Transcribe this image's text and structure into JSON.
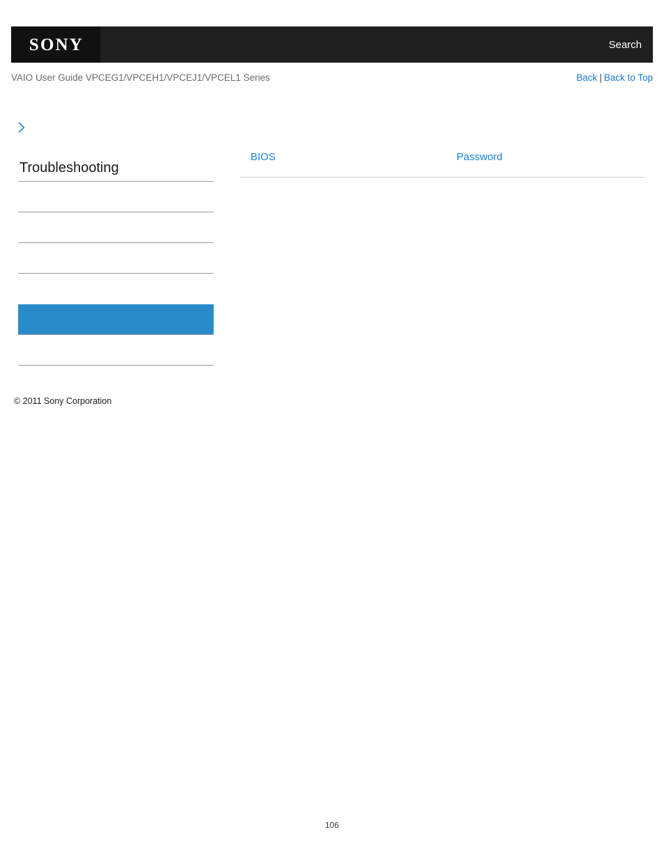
{
  "header": {
    "logo_text": "SONY",
    "search_label": "Search",
    "logo_icon": "sony-logo",
    "background_color": "#1f1f1f",
    "logo_block_color": "#111111"
  },
  "sub_header": {
    "guide_title": "VAIO User Guide VPCEG1/VPCEH1/VPCEJ1/VPCEL1 Series",
    "back_label": "Back",
    "separator": "|",
    "back_to_top_label": "Back to Top",
    "link_color": "#1a78d2"
  },
  "breadcrumb": {
    "icon": "chevron-right-icon",
    "icon_color": "#2a8bcb",
    "label": ""
  },
  "sidebar": {
    "heading": "Troubleshooting",
    "active_color": "#2a8bcb",
    "items": [
      {
        "label": "",
        "active": false
      },
      {
        "label": "",
        "active": false
      },
      {
        "label": "",
        "active": false
      },
      {
        "label": "",
        "active": true
      },
      {
        "label": "",
        "active": false
      }
    ]
  },
  "footer": {
    "copyright": "© 2011 Sony Corporation"
  },
  "content": {
    "links": [
      {
        "label": "BIOS"
      },
      {
        "label": "Password"
      }
    ],
    "link_color": "#1a7fd4"
  },
  "page": {
    "number": "106"
  }
}
